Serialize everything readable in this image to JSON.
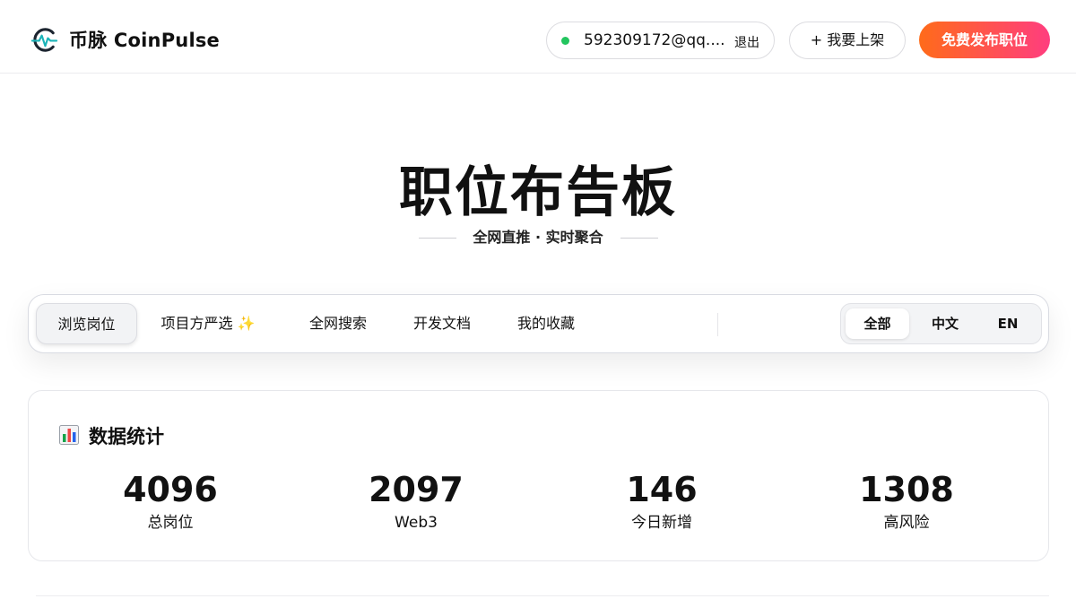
{
  "header": {
    "brand": "币脉 CoinPulse",
    "user_email": "592309172@qq....",
    "logout_label": "退出",
    "list_label": "+ 我要上架",
    "publish_label": "免费发布职位",
    "status_color": "#22c55e"
  },
  "hero": {
    "title": "职位布告板",
    "subtitle": "全网直推 · 实时聚合"
  },
  "nav": {
    "tabs": [
      {
        "label": "浏览岗位",
        "active": true
      },
      {
        "label": "项目方严选 ✨",
        "active": false
      },
      {
        "label": "全网搜索",
        "active": false
      },
      {
        "label": "开发文档",
        "active": false
      },
      {
        "label": "我的收藏",
        "active": false
      }
    ],
    "languages": [
      {
        "label": "全部",
        "active": true
      },
      {
        "label": "中文",
        "active": false
      },
      {
        "label": "EN",
        "active": false
      }
    ]
  },
  "stats": {
    "title": "数据统计",
    "icon": "bar-chart-icon",
    "items": [
      {
        "value": "4096",
        "label": "总岗位"
      },
      {
        "value": "2097",
        "label": "Web3"
      },
      {
        "value": "146",
        "label": "今日新增"
      },
      {
        "value": "1308",
        "label": "高风险"
      }
    ]
  },
  "colors": {
    "accent_gradient_start": "#ff6b1a",
    "accent_gradient_end": "#ff3d7f",
    "logo_teal": "#1ab3b8",
    "logo_dark": "#1c2530"
  }
}
